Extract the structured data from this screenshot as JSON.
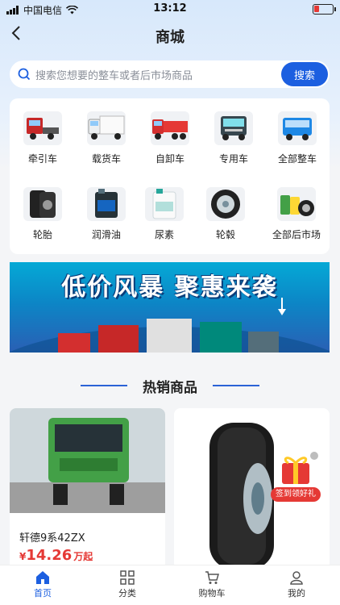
{
  "status_bar": {
    "carrier": "中国电信",
    "time": "13:12"
  },
  "header": {
    "title": "商城"
  },
  "search": {
    "placeholder": "搜索您想要的整车或者后市场商品",
    "button_label": "搜索"
  },
  "categories": [
    {
      "label": "牵引车",
      "icon": "tractor-truck-icon"
    },
    {
      "label": "载货车",
      "icon": "cargo-truck-icon"
    },
    {
      "label": "自卸车",
      "icon": "dump-truck-icon"
    },
    {
      "label": "专用车",
      "icon": "special-truck-icon"
    },
    {
      "label": "全部整车",
      "icon": "all-trucks-icon"
    },
    {
      "label": "轮胎",
      "icon": "tire-icon"
    },
    {
      "label": "润滑油",
      "icon": "lubricant-icon"
    },
    {
      "label": "尿素",
      "icon": "urea-icon"
    },
    {
      "label": "轮毂",
      "icon": "wheel-hub-icon"
    },
    {
      "label": "全部后市场",
      "icon": "all-aftermarket-icon"
    }
  ],
  "banner": {
    "text": "低价风暴 聚惠来袭"
  },
  "hot_section": {
    "title": "热销商品"
  },
  "products": [
    {
      "name": "轩德9系42ZX",
      "currency": "¥",
      "price": "14.26",
      "unit": "万起"
    },
    {
      "name": "",
      "currency": "",
      "price": "",
      "unit": ""
    }
  ],
  "gift_badge": {
    "label": "签到领好礼"
  },
  "tabbar": [
    {
      "label": "首页",
      "icon": "home-icon",
      "active": true
    },
    {
      "label": "分类",
      "icon": "category-grid-icon",
      "active": false
    },
    {
      "label": "购物车",
      "icon": "cart-icon",
      "active": false
    },
    {
      "label": "我的",
      "icon": "profile-icon",
      "active": false
    }
  ],
  "colors": {
    "primary": "#1c5fe0",
    "price": "#e53935",
    "banner_top": "#05a9d6"
  }
}
